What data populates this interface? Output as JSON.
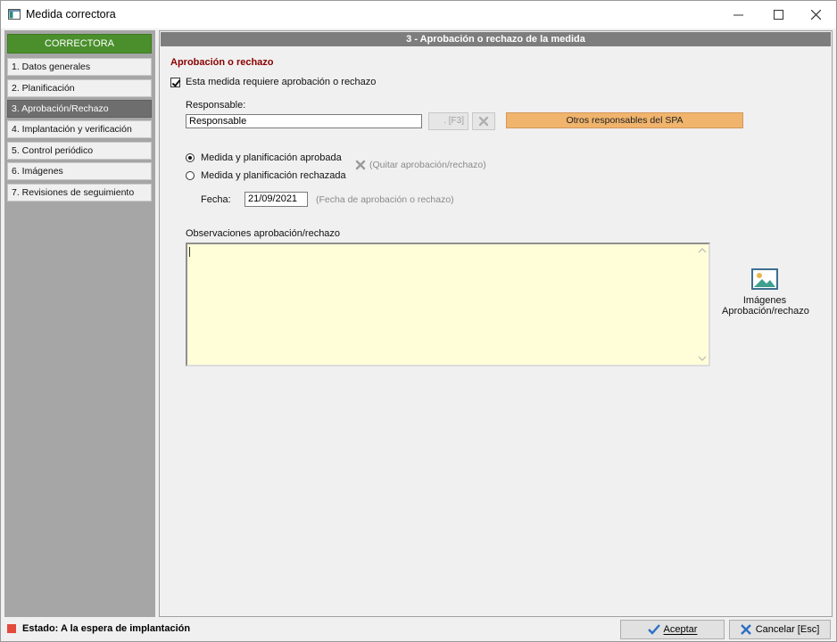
{
  "window": {
    "title": "Medida correctora",
    "minimize_icon": "minimize-icon",
    "maximize_icon": "maximize-icon",
    "close_icon": "close-icon"
  },
  "sidebar": {
    "header": "CORRECTORA",
    "header_color": "#4a8f2c",
    "items": [
      {
        "label": "1. Datos generales",
        "active": false
      },
      {
        "label": "2. Planificación",
        "active": false
      },
      {
        "label": "3. Aprobación/Rechazo",
        "active": true
      },
      {
        "label": "4. Implantación y verificación",
        "active": false
      },
      {
        "label": "5. Control periódico",
        "active": false
      },
      {
        "label": "6. Imágenes",
        "active": false
      },
      {
        "label": "7. Revisiones de seguimiento",
        "active": false
      }
    ]
  },
  "main": {
    "section_header": "3 - Aprobación o rechazo de la medida",
    "section_title": "Aprobación o rechazo",
    "section_title_color": "#8b0000",
    "requires_checkbox": {
      "label": "Esta medida requiere aprobación o rechazo",
      "checked": true
    },
    "responsable": {
      "label": "Responsable:",
      "value": "Responsable",
      "lookup_button": ". [F3]",
      "others_button": "Otros responsables del SPA",
      "others_button_color": "#f0b46d"
    },
    "decision": {
      "options": [
        {
          "label": "Medida y planificación aprobada",
          "selected": true
        },
        {
          "label": "Medida y planificación rechazada",
          "selected": false
        }
      ],
      "remove_label": "(Quitar aprobación/rechazo)"
    },
    "fecha": {
      "label": "Fecha:",
      "value": "21/09/2021",
      "hint": "(Fecha de aprobación o rechazo)"
    },
    "observaciones": {
      "label": "Observaciones aprobación/rechazo",
      "value": ""
    },
    "images_button": {
      "line1": "Imágenes",
      "line2": "Aprobación/rechazo",
      "icon": "image-icon"
    }
  },
  "status_bar": {
    "text": "Estado: A la espera de implantación",
    "indicator_color": "#e24a3c"
  },
  "buttons": {
    "accept": "Aceptar",
    "cancel": "Cancelar [Esc]"
  }
}
